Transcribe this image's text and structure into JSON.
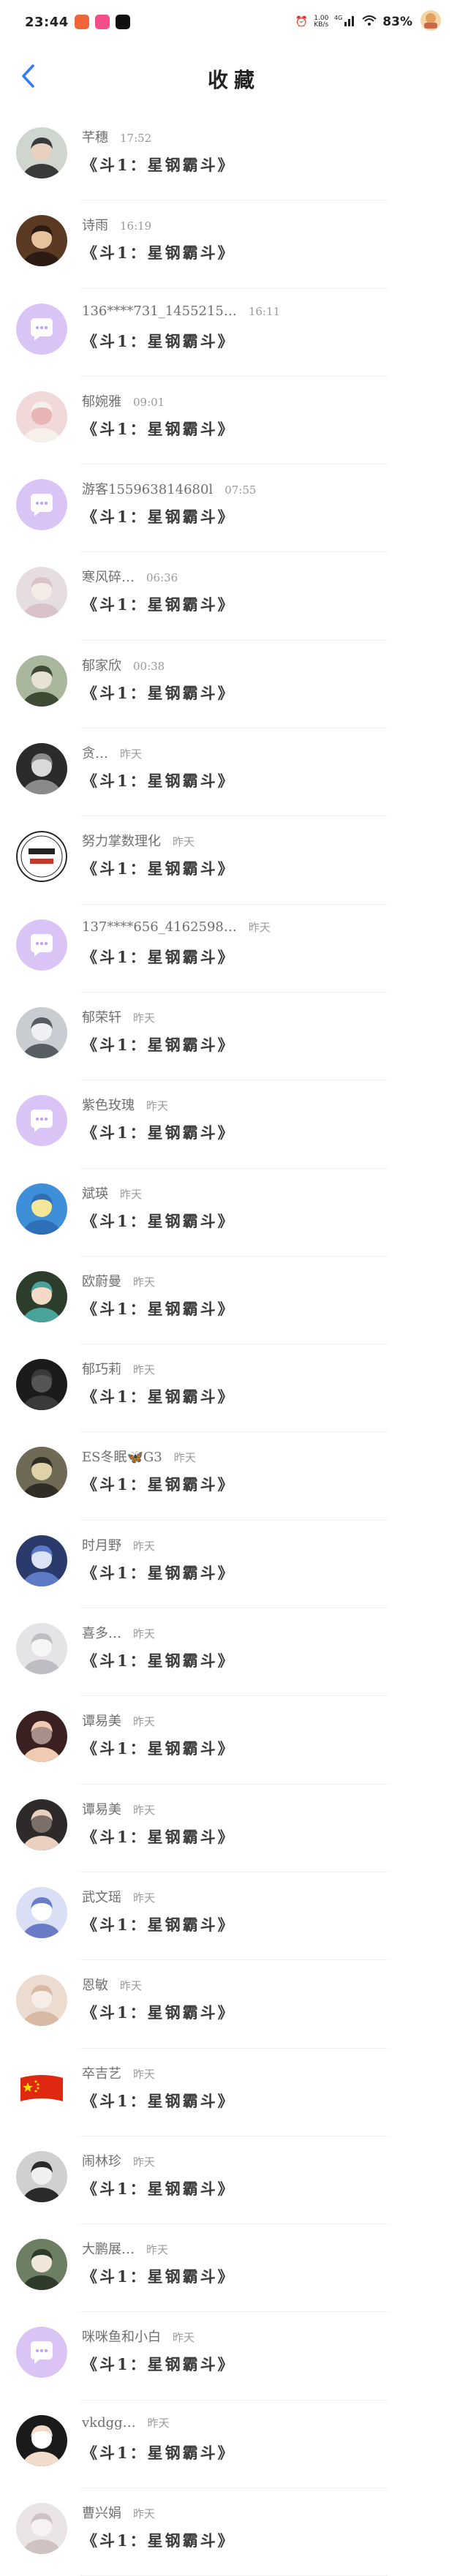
{
  "status_bar": {
    "time": "23:44",
    "net_speed_top": "1.00",
    "net_speed_bottom": "KB/s",
    "network": "4G",
    "battery": "83%"
  },
  "header": {
    "title": "收藏"
  },
  "items": [
    {
      "name": "芊穗",
      "time": "17:52",
      "title": "《斗1：星钢霸斗》"
    },
    {
      "name": "诗雨",
      "time": "16:19",
      "title": "《斗1：星钢霸斗》"
    },
    {
      "name": "136****731_1455215…",
      "time": "16:11",
      "title": "《斗1：星钢霸斗》"
    },
    {
      "name": "郁婉雅",
      "time": "09:01",
      "title": "《斗1：星钢霸斗》"
    },
    {
      "name": "游客155963814680l",
      "time": "07:55",
      "title": "《斗1：星钢霸斗》"
    },
    {
      "name": "寒风碎…",
      "time": "06:36",
      "title": "《斗1：星钢霸斗》"
    },
    {
      "name": "郁家欣",
      "time": "00:38",
      "title": "《斗1：星钢霸斗》"
    },
    {
      "name": "贪…",
      "time": "昨天",
      "title": "《斗1：星钢霸斗》"
    },
    {
      "name": "努力掌数理化",
      "time": "昨天",
      "title": "《斗1：星钢霸斗》"
    },
    {
      "name": "137****656_4162598…",
      "time": "昨天",
      "title": "《斗1：星钢霸斗》"
    },
    {
      "name": "郁荣轩",
      "time": "昨天",
      "title": "《斗1：星钢霸斗》"
    },
    {
      "name": "紫色玫瑰",
      "time": "昨天",
      "title": "《斗1：星钢霸斗》"
    },
    {
      "name": "斌瑛",
      "time": "昨天",
      "title": "《斗1：星钢霸斗》"
    },
    {
      "name": "欧蔚曼",
      "time": "昨天",
      "title": "《斗1：星钢霸斗》"
    },
    {
      "name": "郁巧莉",
      "time": "昨天",
      "title": "《斗1：星钢霸斗》"
    },
    {
      "name": "ES冬眠🦋G3",
      "time": "昨天",
      "title": "《斗1：星钢霸斗》"
    },
    {
      "name": "时月野",
      "time": "昨天",
      "title": "《斗1：星钢霸斗》"
    },
    {
      "name": "喜多…",
      "time": "昨天",
      "title": "《斗1：星钢霸斗》"
    },
    {
      "name": "谭易美",
      "time": "昨天",
      "title": "《斗1：星钢霸斗》"
    },
    {
      "name": "谭易美",
      "time": "昨天",
      "title": "《斗1：星钢霸斗》"
    },
    {
      "name": "武文瑶",
      "time": "昨天",
      "title": "《斗1：星钢霸斗》"
    },
    {
      "name": "恩敏",
      "time": "昨天",
      "title": "《斗1：星钢霸斗》"
    },
    {
      "name": "卒吉艺",
      "time": "昨天",
      "title": "《斗1：星钢霸斗》"
    },
    {
      "name": "闹林珍",
      "time": "昨天",
      "title": "《斗1：星钢霸斗》"
    },
    {
      "name": "大鹏展…",
      "time": "昨天",
      "title": "《斗1：星钢霸斗》"
    },
    {
      "name": "咪咪鱼和小白",
      "time": "昨天",
      "title": "《斗1：星钢霸斗》"
    },
    {
      "name": "vkdgg…",
      "time": "昨天",
      "title": "《斗1：星钢霸斗》"
    },
    {
      "name": "曹兴娟",
      "time": "昨天",
      "title": "《斗1：星钢霸斗》"
    }
  ],
  "colors": {
    "accent": "#2f7cf6",
    "default_avatar": "#d9c4f5",
    "text_title": "#3a3a3a",
    "text_meta": "#9a9a9a"
  },
  "icons": [
    "back-arrow-icon",
    "signal-icon",
    "wifi-icon",
    "battery-icon",
    "default-avatar-chat-icon"
  ]
}
